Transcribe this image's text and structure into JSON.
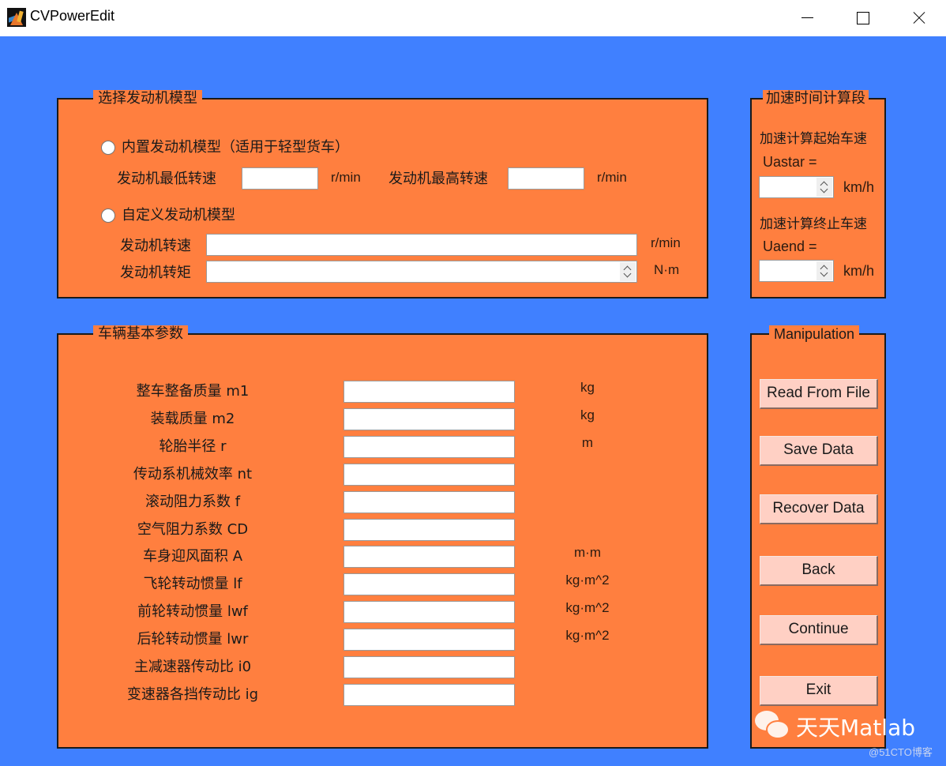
{
  "window": {
    "title": "CVPowerEdit",
    "icon": "matlab-logo-icon",
    "controls": [
      "minimize-icon",
      "maximize-icon",
      "close-icon"
    ]
  },
  "colors": {
    "background": "#4080ff",
    "panel": "#ff7f3f",
    "button": "#ffd0c4",
    "text": "#1a1a1a"
  },
  "engine_panel": {
    "title": "选择发动机模型",
    "builtin_radio_label": "内置发动机模型（适用于轻型货车）",
    "builtin_selected": false,
    "min_speed_label": "发动机最低转速",
    "min_speed_value": "",
    "min_speed_unit": "r/min",
    "max_speed_label": "发动机最高转速",
    "max_speed_value": "",
    "max_speed_unit": "r/min",
    "custom_radio_label": "自定义发动机模型",
    "custom_selected": false,
    "speed_label": "发动机转速",
    "speed_value": "",
    "speed_unit": "r/min",
    "torque_label": "发动机转矩",
    "torque_value": "",
    "torque_unit": "N·m"
  },
  "accel_panel": {
    "title": "加速时间计算段",
    "start_label": "加速计算起始车速",
    "start_var": "Uastar =",
    "start_value": "",
    "start_unit": "km/h",
    "end_label": "加速计算终止车速",
    "end_var": "Uaend =",
    "end_value": "",
    "end_unit": "km/h"
  },
  "vehicle_panel": {
    "title": "车辆基本参数",
    "params": [
      {
        "label": "整车整备质量 m1",
        "value": "",
        "unit": "kg"
      },
      {
        "label": "装载质量 m2",
        "value": "",
        "unit": "kg"
      },
      {
        "label": "轮胎半径 r",
        "value": "",
        "unit": "m"
      },
      {
        "label": "传动系机械效率 nt",
        "value": "",
        "unit": ""
      },
      {
        "label": "滚动阻力系数 f",
        "value": "",
        "unit": ""
      },
      {
        "label": "空气阻力系数 CD",
        "value": "",
        "unit": ""
      },
      {
        "label": "车身迎风面积 A",
        "value": "",
        "unit": "m·m"
      },
      {
        "label": "飞轮转动惯量 lf",
        "value": "",
        "unit": "kg·m^2"
      },
      {
        "label": "前轮转动惯量 lwf",
        "value": "",
        "unit": "kg·m^2"
      },
      {
        "label": "后轮转动惯量 lwr",
        "value": "",
        "unit": "kg·m^2"
      },
      {
        "label": "主减速器传动比 i0",
        "value": "",
        "unit": ""
      },
      {
        "label": "变速器各挡传动比 ig",
        "value": "",
        "unit": ""
      }
    ]
  },
  "manipulation_panel": {
    "title": "Manipulation",
    "buttons": [
      {
        "label": "Read From File"
      },
      {
        "label": "Save Data"
      },
      {
        "label": "Recover Data"
      },
      {
        "label": "Back"
      },
      {
        "label": "Continue"
      },
      {
        "label": "Exit"
      }
    ]
  },
  "watermark": {
    "icon": "wechat-icon",
    "text": "天天Matlab",
    "credit": "@51CTO博客"
  }
}
